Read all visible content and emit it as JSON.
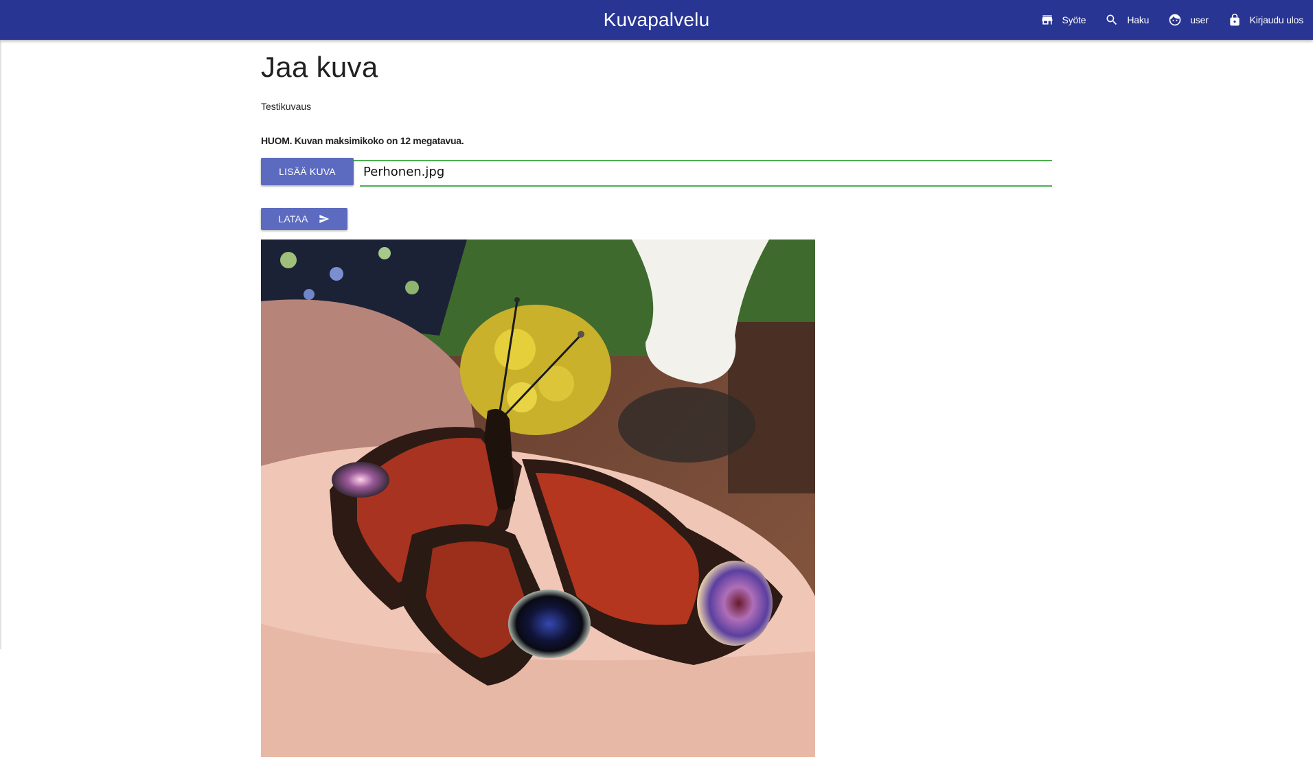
{
  "app": {
    "title": "Kuvapalvelu"
  },
  "nav": {
    "items": [
      {
        "label": "Syöte",
        "icon": "store-icon"
      },
      {
        "label": "Haku",
        "icon": "search-icon"
      },
      {
        "label": "user",
        "icon": "face-icon"
      },
      {
        "label": "Kirjaudu ulos",
        "icon": "lock-icon"
      }
    ]
  },
  "upload": {
    "title": "Jaa kuva",
    "description_value": "Testikuvaus",
    "note": "HUOM. Kuvan maksimikoko on 12 megatavua.",
    "add_button": "LISÄÄ KUVA",
    "file_name": "Perhonen.jpg",
    "upload_button": "LATAA",
    "upload_icon": "send-icon",
    "preview_description": "Preview of the selected image: a peacock butterfly resting on a hand"
  },
  "colors": {
    "appbar": "#283593",
    "button": "#5c6bc0",
    "input_underline": "#4caf50"
  }
}
